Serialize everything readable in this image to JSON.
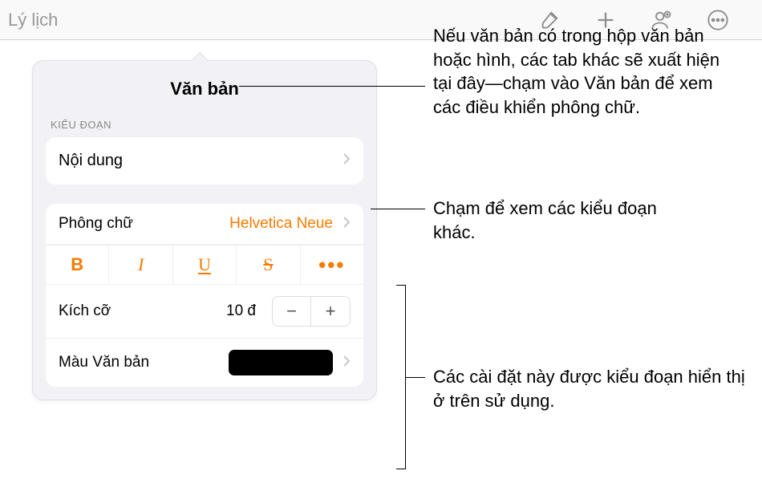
{
  "toolbar": {
    "title": "Lý lịch"
  },
  "popover": {
    "tab_label": "Văn bản",
    "section_label": "KIỂU ĐOẠN",
    "style_name": "Nội dung",
    "font_label": "Phông chữ",
    "font_value": "Helvetica Neue",
    "format_buttons": {
      "bold": "B",
      "italic": "I",
      "underline": "U",
      "strike": "S",
      "more": "•••"
    },
    "size_label": "Kích cỡ",
    "size_value": "10 đ",
    "stepper": {
      "minus": "−",
      "plus": "+"
    },
    "color_label": "Màu Văn bản",
    "color_value": "#000000"
  },
  "callouts": {
    "text_tab": "Nếu văn bản có trong hộp văn bản hoặc hình, các tab khác sẽ xuất hiện tại đây—chạm vào Văn bản để xem các điều khiển phông chữ.",
    "paragraph_style": "Chạm để xem các kiểu đoạn khác.",
    "settings": "Các cài đặt này được kiểu đoạn hiển thị ở trên sử dụng."
  }
}
